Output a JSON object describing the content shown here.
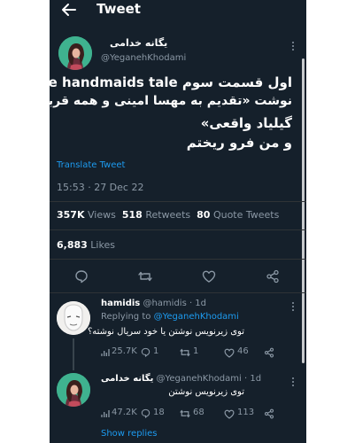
{
  "header": {
    "title": "Tweet"
  },
  "tweet": {
    "author_name": "یگانه خدامی",
    "author_handle": "@YeganehKhodami",
    "lines": [
      "اول قسمت سوم the handmaids tale",
      "نوشت «تقدیم به مهسا امینی و همه قربانیان",
      "گیلیاد واقعی»",
      "و من فرو ریختم"
    ],
    "translate": "Translate Tweet",
    "timestamp": "15:53 · 27 Dec 22",
    "views_count": "357K",
    "views_label": "Views",
    "retweets_count": "518",
    "retweets_label": "Retweets",
    "quotes_count": "80",
    "quotes_label": "Quote Tweets",
    "likes_count": "6,883",
    "likes_label": "Likes"
  },
  "replies": [
    {
      "name": "hamidis",
      "meta": "@hamidis · 1d",
      "replying_prefix": "Replying to",
      "replying_handle": "@YeganehKhodami",
      "text": "توی زیرنویس نوشتن یا خود سریال نوشته؟",
      "views": "25.7K",
      "replies": "1",
      "retweets": "1",
      "likes": "46"
    },
    {
      "name": "یگانه خدامی",
      "meta": "@YeganehKhodami · 1d",
      "text": "توی زیرنویس نوشتن",
      "views": "47.2K",
      "replies": "18",
      "retweets": "68",
      "likes": "113"
    }
  ],
  "show_replies": "Show replies",
  "colors": {
    "background": "#15202b",
    "accent": "#1d9bf0",
    "muted": "#8b98a5",
    "divider": "#2f3336"
  }
}
